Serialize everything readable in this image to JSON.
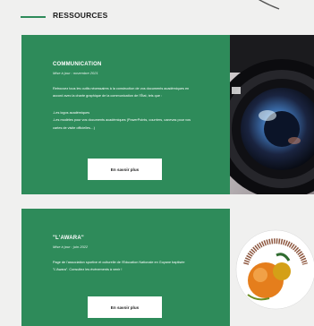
{
  "section": {
    "title": "RESSOURCES"
  },
  "cards": [
    {
      "title": "COMMUNICATION",
      "date": "Mise à jour : novembre 2021",
      "paragraphs": [
        "Retrouvez tous les outils nécessaires à la construction de vos documents académiques en accord avec la charte graphique de la communication de l'État, tels que :",
        "-Les logos académiques\n-Les modèles pour vos documents académiques (PowerPoints, courriers, canevas pour vos cartes de visite officielles…)"
      ],
      "button_label": "En savoir plus",
      "image": "camera-lens-photo"
    },
    {
      "title": "\"L'AWARA\"",
      "date": "Mise à jour : juin 2022",
      "paragraphs": [
        "Page de l'association sportive et culturelle de l'Education Nationale en Guyane baptisée \"L'Awara\". Consultez les évènements à venir !"
      ],
      "button_label": "En savoir plus",
      "image": "awara-association-logo",
      "logo_text": "L'AWARA Association Sportive et Culturelle de l'Education Nationale en Guyane"
    }
  ],
  "colors": {
    "accent": "#2e8b5a",
    "page_bg": "#f0f0ef"
  }
}
